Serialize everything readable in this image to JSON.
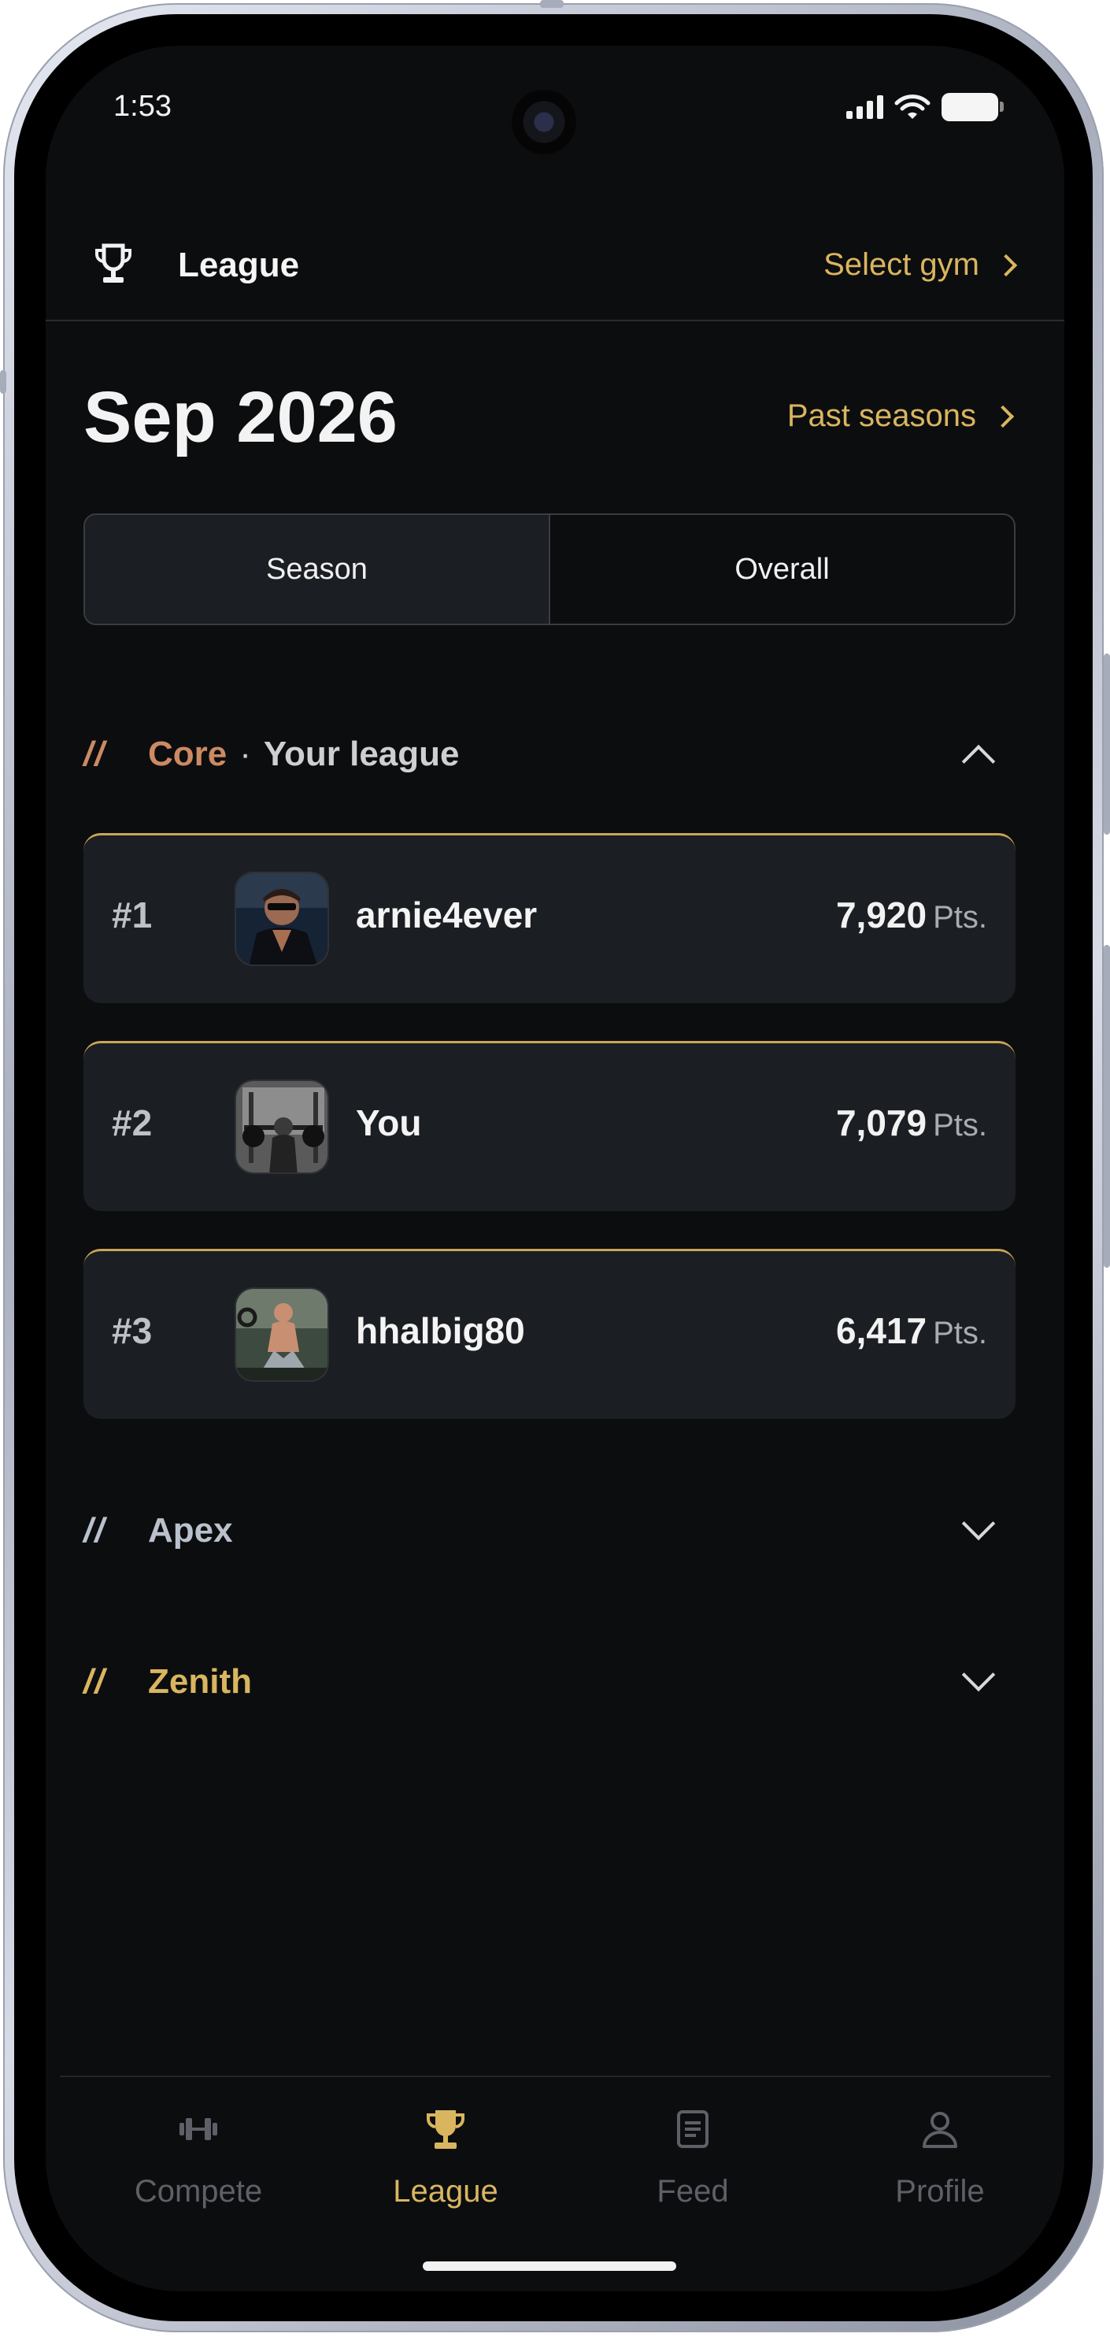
{
  "status": {
    "time": "1:53"
  },
  "header": {
    "title": "League",
    "select_gym": "Select gym"
  },
  "season": {
    "title": "Sep 2026",
    "past_seasons": "Past seasons"
  },
  "segments": [
    {
      "label": "Season",
      "active": true
    },
    {
      "label": "Overall",
      "active": false
    }
  ],
  "leagues": [
    {
      "slashes": "//",
      "name": "Core",
      "separator": "·",
      "tag": "Your league",
      "color": "#cc8a62",
      "expanded": true
    },
    {
      "slashes": "//",
      "name": "Apex",
      "color": "#b9c1cc",
      "expanded": false
    },
    {
      "slashes": "//",
      "name": "Zenith",
      "color": "#d9b55f",
      "expanded": false
    }
  ],
  "rankings": [
    {
      "rank": "#1",
      "name": "arnie4ever",
      "points": "7,920",
      "unit": "Pts."
    },
    {
      "rank": "#2",
      "name": "You",
      "points": "7,079",
      "unit": "Pts."
    },
    {
      "rank": "#3",
      "name": "hhalbig80",
      "points": "6,417",
      "unit": "Pts."
    }
  ],
  "tabs": [
    {
      "label": "Compete",
      "icon": "dumbbell-icon",
      "active": false
    },
    {
      "label": "League",
      "icon": "trophy-icon",
      "active": true
    },
    {
      "label": "Feed",
      "icon": "document-icon",
      "active": false
    },
    {
      "label": "Profile",
      "icon": "person-icon",
      "active": false
    }
  ],
  "colors": {
    "accent": "#d9b55f",
    "background": "#0c0d0f",
    "card": "#1b1e22"
  }
}
